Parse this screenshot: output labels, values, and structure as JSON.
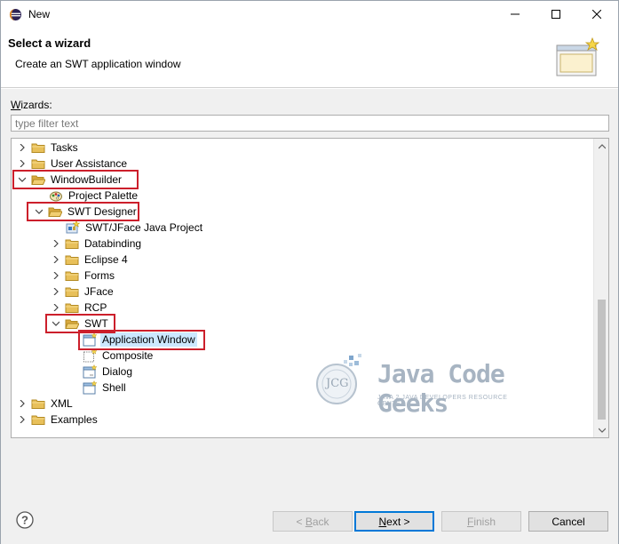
{
  "window": {
    "title": "New"
  },
  "banner": {
    "heading": "Select a wizard",
    "description": "Create an SWT application window"
  },
  "wizards": {
    "label_prefix": "W",
    "label_rest": "izards:",
    "filter_placeholder": "type filter text",
    "filter_value": ""
  },
  "tree": {
    "items": [
      {
        "label": "Tasks",
        "expanded": false,
        "icon": "folder-icon",
        "depth": 0
      },
      {
        "label": "User Assistance",
        "expanded": false,
        "icon": "folder-icon",
        "depth": 0
      },
      {
        "label": "WindowBuilder",
        "expanded": true,
        "icon": "folder-icon",
        "depth": 0
      },
      {
        "label": "Project Palette",
        "icon": "palette-icon",
        "depth": 1
      },
      {
        "label": "SWT Designer",
        "expanded": true,
        "icon": "folder-icon",
        "depth": 1
      },
      {
        "label": "SWT/JFace Java Project",
        "icon": "project-icon",
        "depth": 2
      },
      {
        "label": "Databinding",
        "expanded": false,
        "icon": "folder-icon",
        "depth": 2
      },
      {
        "label": "Eclipse 4",
        "expanded": false,
        "icon": "folder-icon",
        "depth": 2
      },
      {
        "label": "Forms",
        "expanded": false,
        "icon": "folder-icon",
        "depth": 2
      },
      {
        "label": "JFace",
        "expanded": false,
        "icon": "folder-icon",
        "depth": 2
      },
      {
        "label": "RCP",
        "expanded": false,
        "icon": "folder-icon",
        "depth": 2
      },
      {
        "label": "SWT",
        "expanded": true,
        "icon": "folder-icon",
        "depth": 2
      },
      {
        "label": "Application Window",
        "icon": "window-icon",
        "depth": 3,
        "selected": true
      },
      {
        "label": "Composite",
        "icon": "composite-icon",
        "depth": 3
      },
      {
        "label": "Dialog",
        "icon": "dialog-icon",
        "depth": 3
      },
      {
        "label": "Shell",
        "icon": "shell-icon",
        "depth": 3
      },
      {
        "label": "XML",
        "expanded": false,
        "icon": "folder-icon",
        "depth": 0
      },
      {
        "label": "Examples",
        "expanded": false,
        "icon": "folder-icon",
        "depth": 0
      }
    ]
  },
  "watermark": {
    "logo_text": "JCG",
    "brand": "Java Code Geeks",
    "tagline": "JAVA 2 JAVA DEVELOPERS RESOURCE CENTER"
  },
  "footer": {
    "back_prefix": "< ",
    "back_u": "B",
    "back_rest": "ack",
    "next_u": "N",
    "next_rest": "ext >",
    "finish_u": "F",
    "finish_rest": "inish",
    "cancel": "Cancel"
  },
  "colors": {
    "highlight_border": "#cc1f2b",
    "selection_bg": "#cce8ff",
    "default_button_border": "#0078d7",
    "folder_fill": "#e8c05a"
  }
}
